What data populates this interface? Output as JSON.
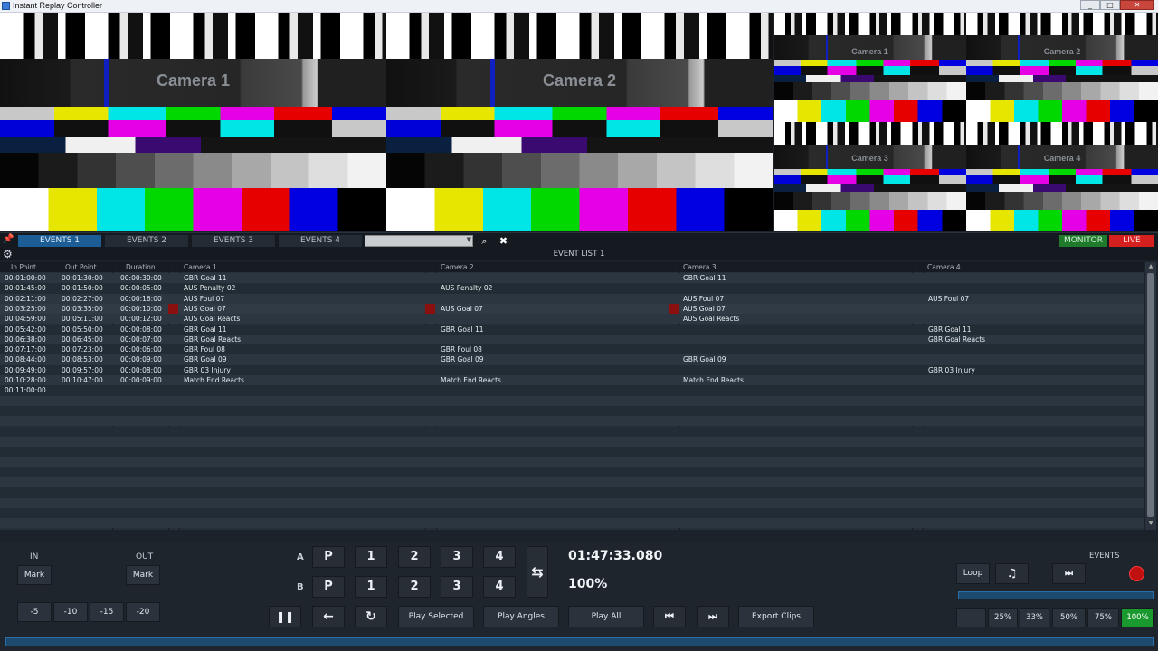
{
  "window": {
    "title": "Instant Replay Controller",
    "buttons": [
      "_",
      "□",
      "✕"
    ]
  },
  "cameras": {
    "large": [
      {
        "label": "Camera 1"
      },
      {
        "label": "Camera 2"
      }
    ],
    "small": [
      {
        "label": "Camera 1"
      },
      {
        "label": "Camera 2"
      },
      {
        "label": "Camera 3"
      },
      {
        "label": "Camera 4"
      }
    ]
  },
  "tabs": [
    {
      "label": "EVENTS 1",
      "active": true
    },
    {
      "label": "EVENTS 2",
      "active": false
    },
    {
      "label": "EVENTS 3",
      "active": false
    },
    {
      "label": "EVENTS 4",
      "active": false
    }
  ],
  "search": {
    "value": "",
    "placeholder": ""
  },
  "mode_buttons": {
    "monitor": "MONITOR",
    "live": "LIVE",
    "monitor_color": "#1f7a2c",
    "live_color": "#d61f1f"
  },
  "event_list": {
    "title": "EVENT LIST 1",
    "columns": [
      "In Point",
      "Out Point",
      "Duration",
      "Camera 1",
      "Camera 2",
      "Camera 3",
      "Camera 4"
    ],
    "rows": [
      [
        "00:01:00:00",
        "00:01:30:00",
        "00:00:30:00",
        "GBR Goal 11",
        "",
        "GBR Goal 11",
        ""
      ],
      [
        "00:01:45:00",
        "00:01:50:00",
        "00:00:05:00",
        "AUS Penalty 02",
        "AUS Penalty 02",
        "",
        ""
      ],
      [
        "00:02:11:00",
        "00:02:27:00",
        "00:00:16:00",
        "AUS Foul 07",
        "",
        "AUS Foul 07",
        "AUS Foul 07"
      ],
      [
        "00:03:25:00",
        "00:03:35:00",
        "00:00:10:00",
        "AUS Goal 07",
        "AUS Goal 07",
        "AUS Goal 07",
        ""
      ],
      [
        "00:04:59:00",
        "00:05:11:00",
        "00:00:12:00",
        "AUS Goal Reacts",
        "",
        "AUS Goal Reacts",
        ""
      ],
      [
        "00:05:42:00",
        "00:05:50:00",
        "00:00:08:00",
        "GBR Goal 11",
        "GBR Goal 11",
        "",
        "GBR Goal 11"
      ],
      [
        "00:06:38:00",
        "00:06:45:00",
        "00:00:07:00",
        "GBR Goal Reacts",
        "",
        "",
        "GBR Goal Reacts"
      ],
      [
        "00:07:17:00",
        "00:07:23:00",
        "00:00:06:00",
        "GBR Foul 08",
        "GBR Foul 08",
        "",
        ""
      ],
      [
        "00:08:44:00",
        "00:08:53:00",
        "00:00:09:00",
        "GBR Goal 09",
        "GBR Goal 09",
        "GBR Goal 09",
        ""
      ],
      [
        "00:09:49:00",
        "00:09:57:00",
        "00:00:08:00",
        "GBR 03 Injury",
        "",
        "",
        "GBR 03 Injury"
      ],
      [
        "00:10:28:00",
        "00:10:47:00",
        "00:00:09:00",
        "Match End Reacts",
        "Match End Reacts",
        "Match End Reacts",
        ""
      ],
      [
        "00:11:00:00",
        "",
        "",
        "",
        "",
        "",
        ""
      ]
    ],
    "selected_row": 3
  },
  "controls": {
    "in_label": "IN",
    "out_label": "OUT",
    "mark": "Mark",
    "offsets": [
      "-5",
      "-10",
      "-15",
      "-20"
    ],
    "row_a": "A",
    "row_b": "B",
    "preset_p": "P",
    "cams": [
      "1",
      "2",
      "3",
      "4"
    ],
    "swap_icon": "⇆",
    "timecode": "01:47:33.080",
    "speed": "100%",
    "play_selected": "Play Selected",
    "play_angles": "Play Angles",
    "play_all": "Play All",
    "export": "Export Clips",
    "loop": "Loop",
    "events_label": "EVENTS",
    "speeds": [
      "25%",
      "33%",
      "50%",
      "75%",
      "100%"
    ],
    "active_speed": "100%",
    "active_speed_color": "#1a9a2e"
  }
}
